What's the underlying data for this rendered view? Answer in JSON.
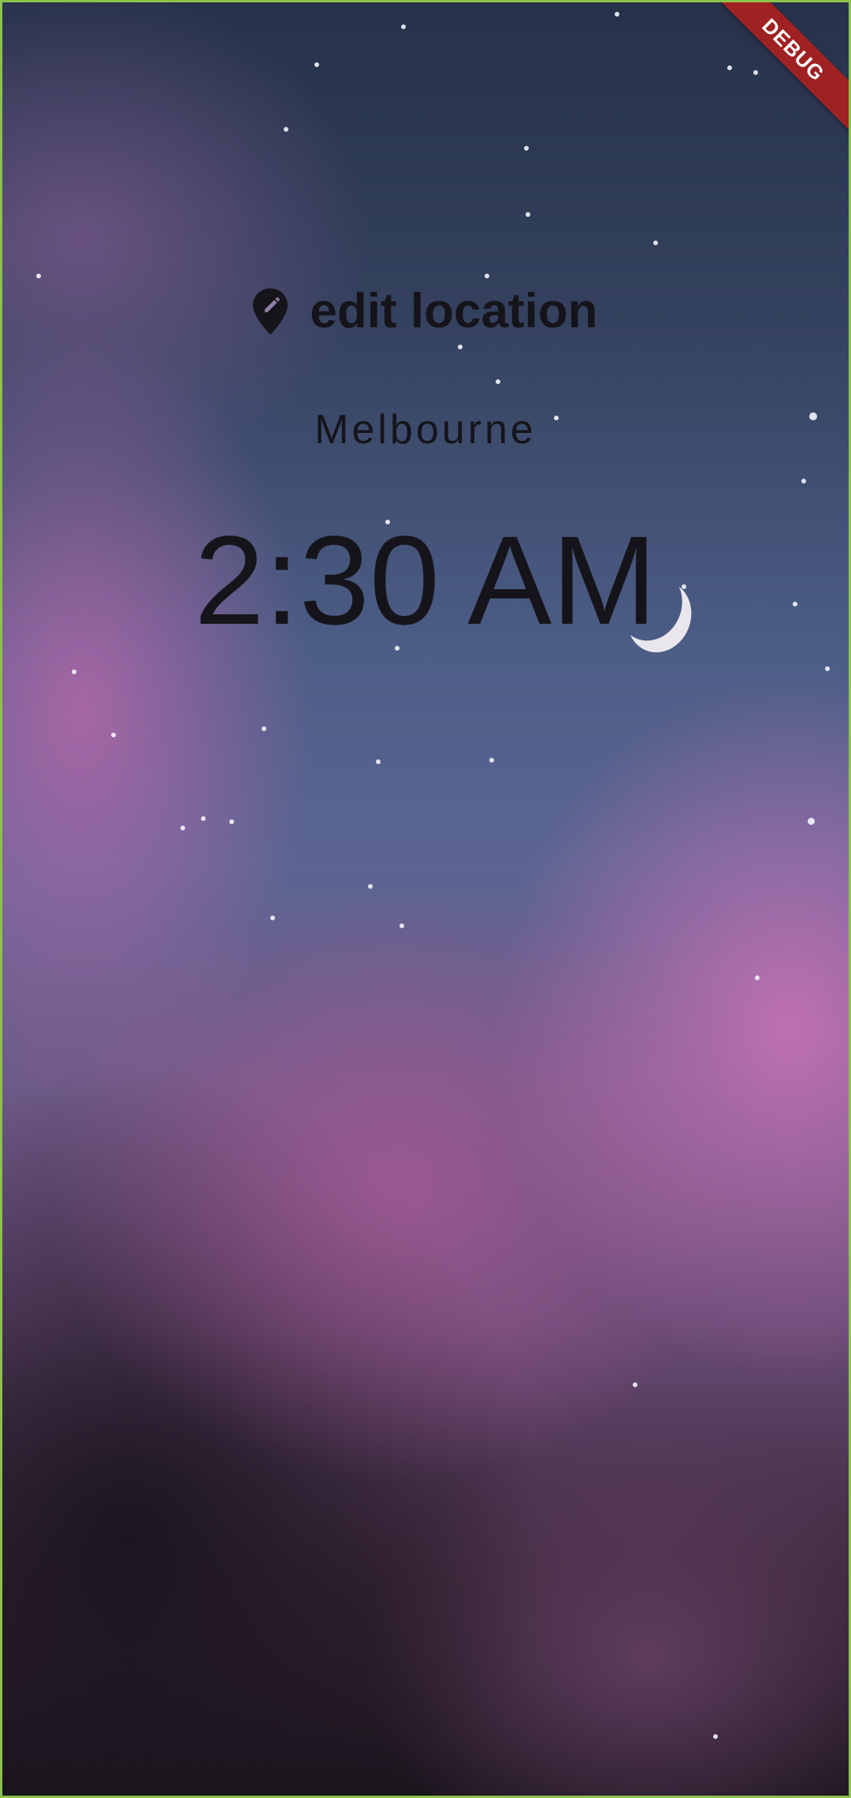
{
  "debug_banner": "DEBUG",
  "header": {
    "edit_location_label": "edit location",
    "edit_location_icon": "edit-location-icon"
  },
  "location": {
    "city": "Melbourne",
    "time": "2:30 AM"
  },
  "theme": {
    "text_color": "#16141b",
    "border_color": "#8bc34a",
    "banner_color": "#a02122",
    "background": "night sky with pink clouds and crescent moon"
  }
}
